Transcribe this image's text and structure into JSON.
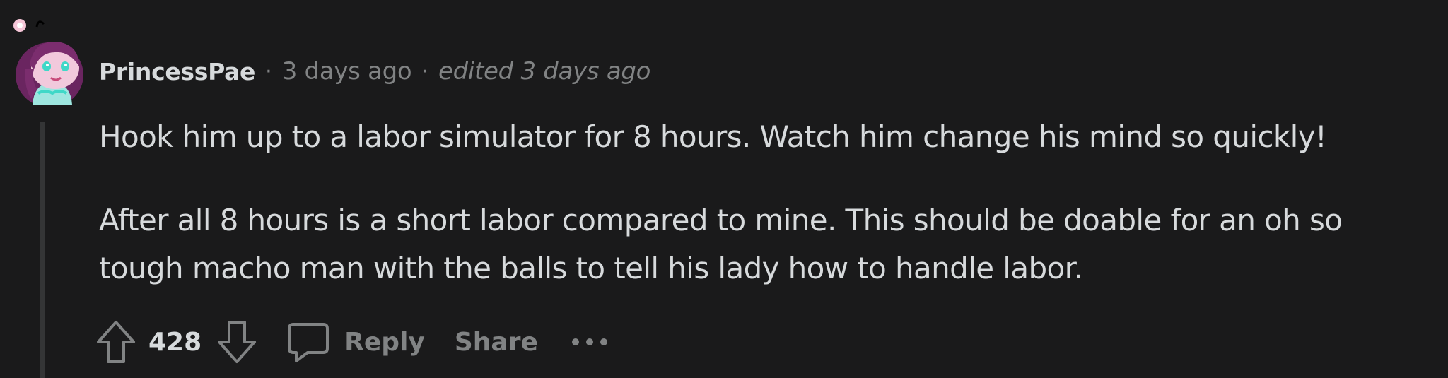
{
  "comment": {
    "author": "PrincessPae",
    "separator": "·",
    "posted": "3 days ago",
    "edited": "edited 3 days ago",
    "paragraphs": [
      "Hook him up to a labor simulator for 8 hours. Watch him change his mind so quickly!",
      "After all 8 hours is a short labor compared to mine. This should be doable for an oh so",
      "tough macho man with the balls to tell his lady how to handle labor."
    ]
  },
  "actions": {
    "upvote_icon": "upvote-arrow-icon",
    "score": "428",
    "downvote_icon": "downvote-arrow-icon",
    "reply_icon": "speech-bubble-icon",
    "reply_label": "Reply",
    "share_label": "Share",
    "more_icon": "ellipsis-icon"
  },
  "colors": {
    "background": "#1a1a1b",
    "text": "#d7dadc",
    "muted": "#818384",
    "thread_line": "#343536",
    "avatar_hair": "#7b2d6e",
    "avatar_face": "#f2c9dc",
    "avatar_accent": "#3fd8c8"
  }
}
